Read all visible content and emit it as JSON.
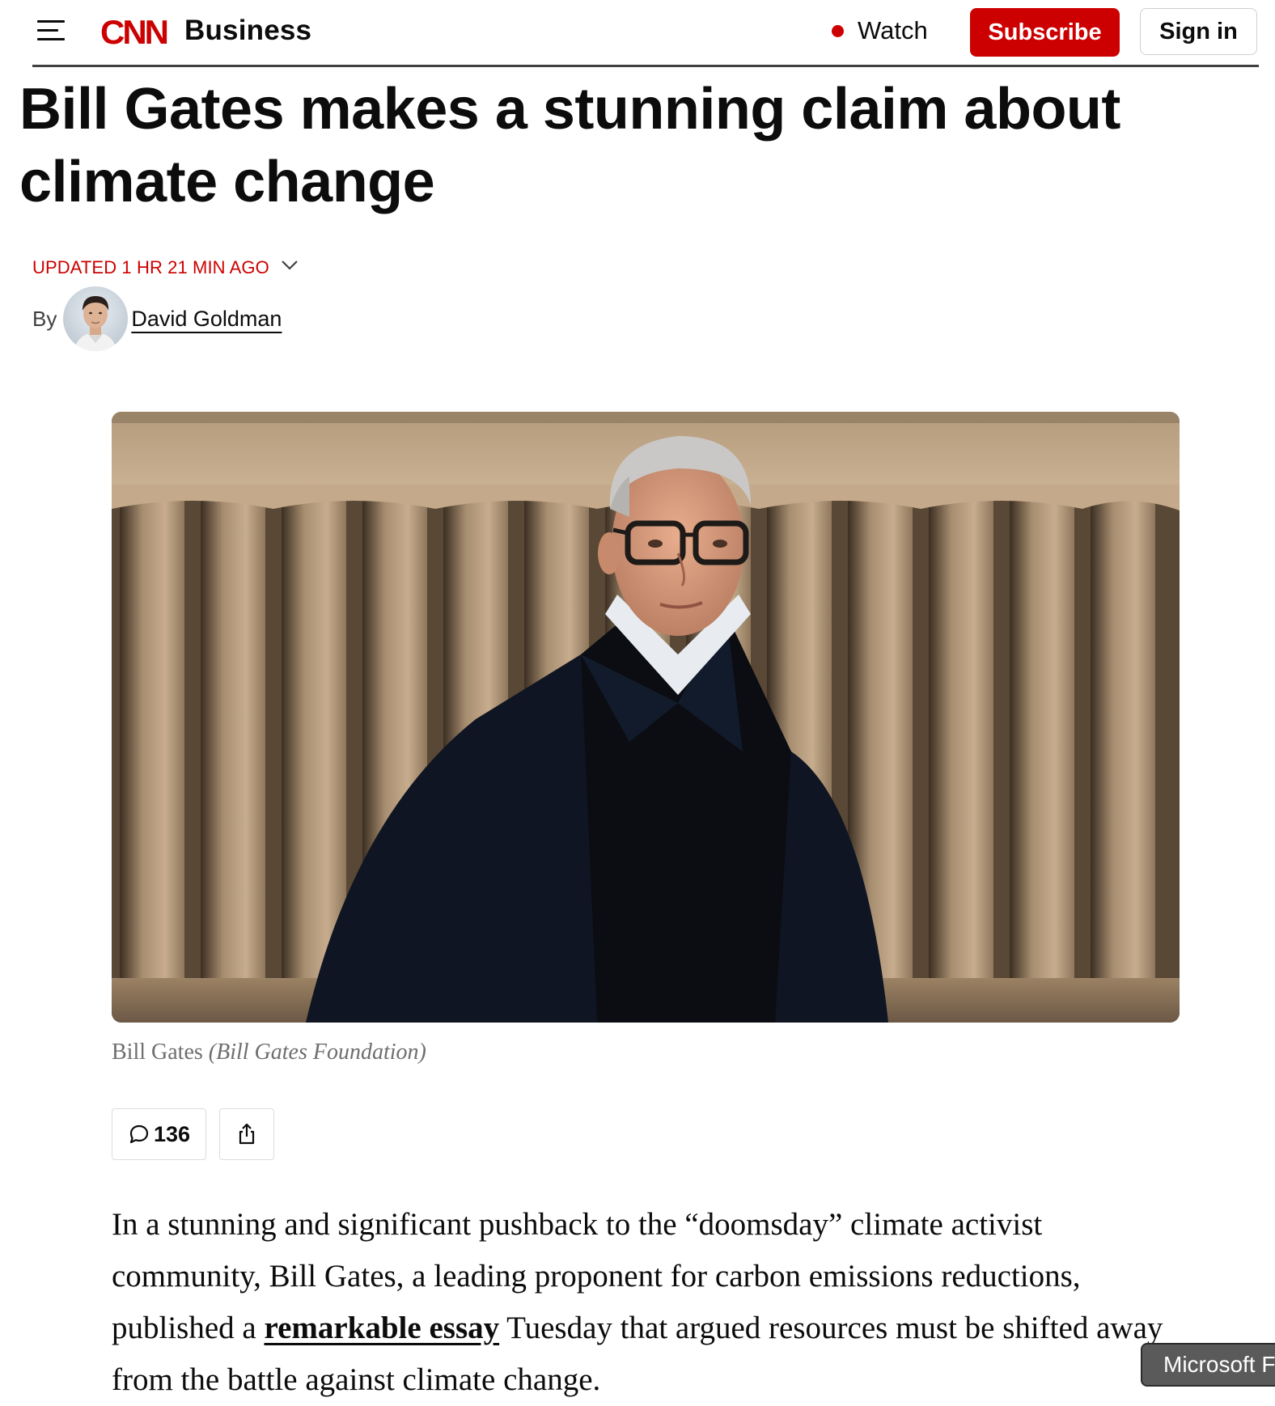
{
  "header": {
    "menu_icon": "hamburger-menu-icon",
    "logo_text": "CNN",
    "section": "Business",
    "watch_label": "Watch",
    "subscribe_label": "Subscribe",
    "signin_label": "Sign in",
    "brand_color": "#cc0000"
  },
  "article": {
    "headline": "Bill Gates makes a stunning claim about climate change",
    "timestamp": "UPDATED 1 HR 21 MIN AGO",
    "byline_prefix": "By",
    "author": "David Goldman",
    "image_caption": "Bill Gates",
    "image_credit": "(Bill Gates Foundation)",
    "comment_count": "136",
    "body": {
      "text_before_link": "In a stunning and significant pushback to the “doomsday” climate activist community, Bill Gates, a leading proponent for carbon emissions reductions, published a ",
      "link_text": "remarkable essay",
      "text_after_link": " Tuesday that argued resources must be shifted away from the battle against climate change."
    }
  },
  "overlay": {
    "popup_label": "Microsoft F"
  }
}
